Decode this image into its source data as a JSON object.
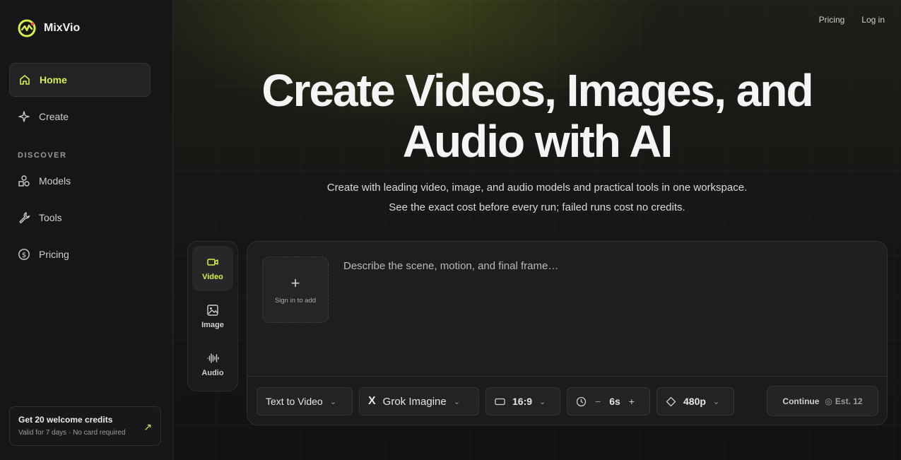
{
  "brand": {
    "name": "MixVio",
    "accent": "#d8f14a"
  },
  "sidebar": {
    "items": [
      {
        "label": "Home",
        "icon": "home-icon",
        "active": true
      },
      {
        "label": "Create",
        "icon": "sparkle-icon"
      }
    ],
    "discover_label": "DISCOVER",
    "discover_items": [
      {
        "label": "Models",
        "icon": "shapes-icon"
      },
      {
        "label": "Tools",
        "icon": "wrench-icon"
      },
      {
        "label": "Pricing",
        "icon": "dollar-circle-icon"
      }
    ],
    "credits": {
      "title": "Get 20 welcome credits",
      "subtitle": "Valid for 7 days · No card required",
      "icon": "arrow-up-right-icon"
    }
  },
  "header": {
    "pricing": "Pricing",
    "login": "Log in"
  },
  "hero": {
    "title_line1": "Create Videos, Images, and",
    "title_line2": "Audio with AI",
    "sub_line1": "Create with leading video, image, and audio models and practical tools in one workspace.",
    "sub_line2": "See the exact cost before every run; failed runs cost no credits."
  },
  "modes": [
    {
      "label": "Video",
      "icon": "video-camera-icon",
      "active": true
    },
    {
      "label": "Image",
      "icon": "image-icon"
    },
    {
      "label": "Audio",
      "icon": "waveform-icon"
    }
  ],
  "composer": {
    "upload_label": "Sign in to add",
    "prompt_placeholder": "Describe the scene, motion, and final frame…",
    "task": "Text to Video",
    "model": "Grok Imagine",
    "model_icon": "x-logo-icon",
    "aspect": "16:9",
    "duration": "6s",
    "resolution": "480p",
    "continue_label": "Continue",
    "estimate": "Est. 12"
  }
}
